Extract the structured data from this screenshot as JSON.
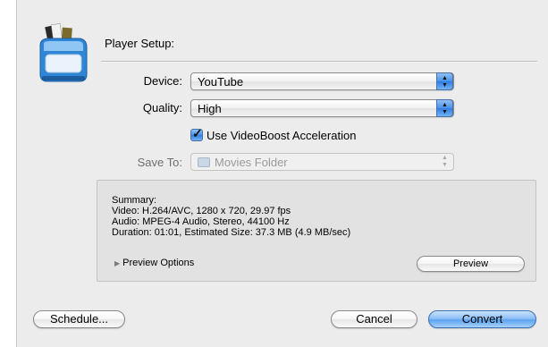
{
  "header": {
    "title": "Player Setup:"
  },
  "form": {
    "device": {
      "label": "Device:",
      "value": "YouTube"
    },
    "quality": {
      "label": "Quality:",
      "value": "High"
    },
    "videoboost": {
      "label": "Use VideoBoost Acceleration",
      "checked": true
    },
    "save_to": {
      "label": "Save To:",
      "value": "Movies Folder",
      "enabled": false
    }
  },
  "summary": {
    "heading": "Summary:",
    "video": "Video: H.264/AVC, 1280 x 720, 29.97 fps",
    "audio": "Audio: MPEG-4 Audio, Stereo, 44100 Hz",
    "duration": "Duration: 01:01, Estimated Size: 37.3 MB (4.9 MB/sec)",
    "preview_options": "Preview Options",
    "preview_button": "Preview"
  },
  "footer": {
    "schedule": "Schedule...",
    "cancel": "Cancel",
    "convert": "Convert"
  },
  "colors": {
    "accent": "#4a90e6",
    "background": "#ececec"
  },
  "icons": {
    "app": "toast-video-converter-icon",
    "arrows": "popup-arrows-icon",
    "folder": "folder-icon",
    "disclosure": "disclosure-triangle-icon",
    "check": "checkmark-icon"
  }
}
